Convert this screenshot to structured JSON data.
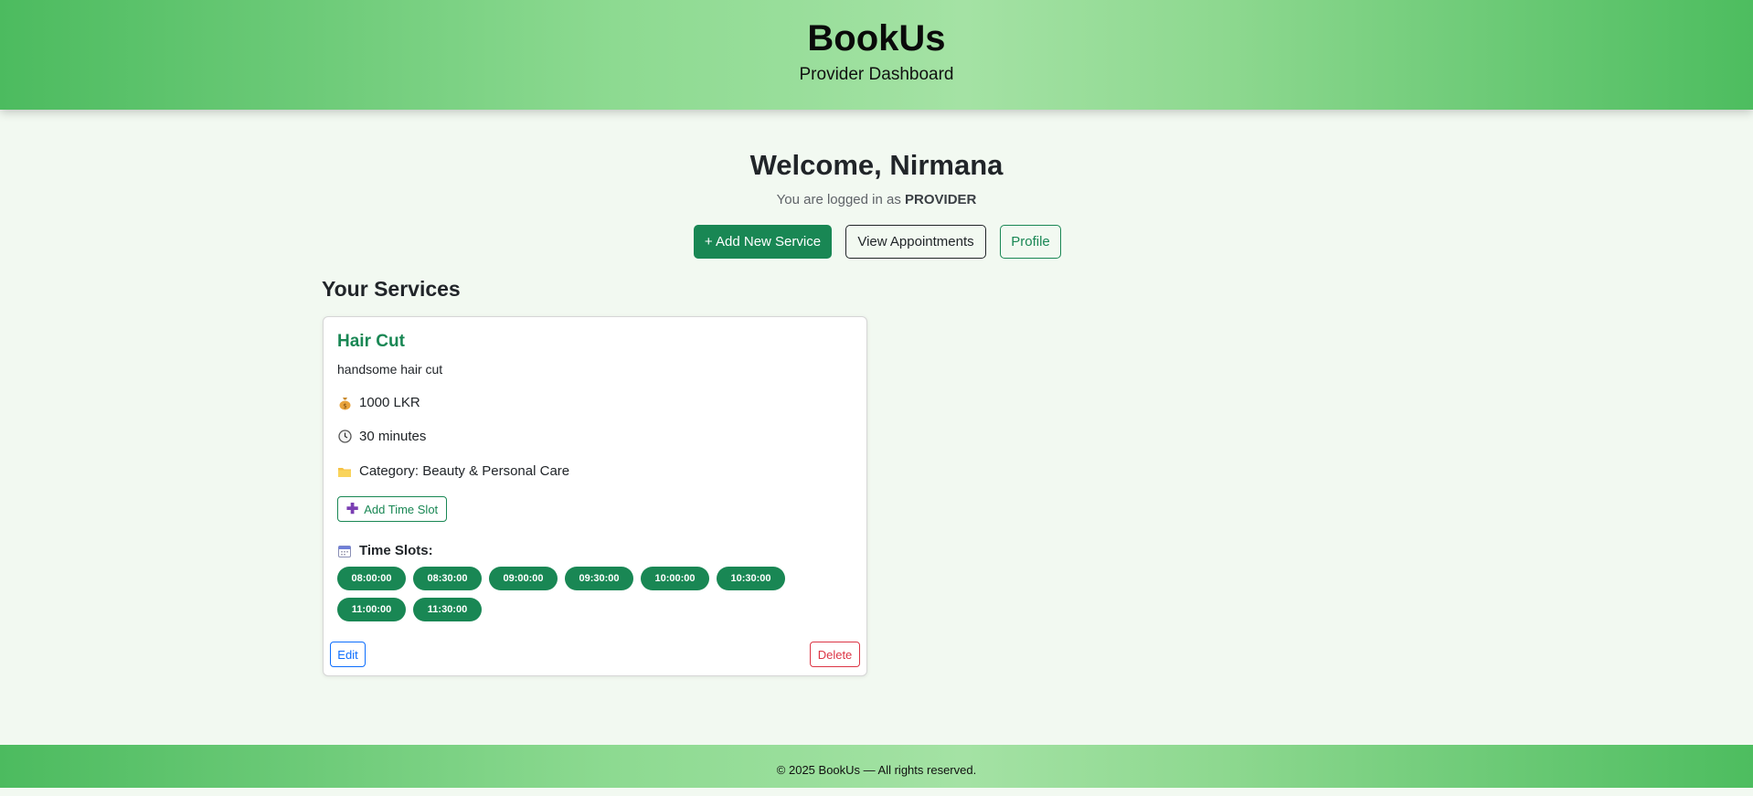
{
  "header": {
    "brand": "BookUs",
    "tagline": "Provider Dashboard"
  },
  "welcome": {
    "title": "Welcome, Nirmana",
    "logged_prefix": "You are logged in as ",
    "role": "PROVIDER"
  },
  "actions": {
    "add_service": "+ Add New Service",
    "view_appointments": "View Appointments",
    "profile": "Profile"
  },
  "services_section": {
    "title": "Your Services"
  },
  "service": {
    "name": "Hair Cut",
    "description": "handsome hair cut",
    "price": "1000 LKR",
    "duration": "30 minutes",
    "category": "Category: Beauty & Personal Care",
    "price_icon": "money-bag-icon",
    "duration_icon": "clock-icon",
    "category_icon": "folder-icon",
    "add_slot_label": "Add Time Slot",
    "slots_label": "Time Slots:",
    "slots": [
      "08:00:00",
      "08:30:00",
      "09:00:00",
      "09:30:00",
      "10:00:00",
      "10:30:00",
      "11:00:00",
      "11:30:00"
    ],
    "edit_label": "Edit",
    "delete_label": "Delete"
  },
  "colors": {
    "primary": "#198754",
    "edit": "#0d6efd",
    "delete": "#dc3545"
  },
  "footer": {
    "text": "© 2025 BookUs — All rights reserved."
  }
}
